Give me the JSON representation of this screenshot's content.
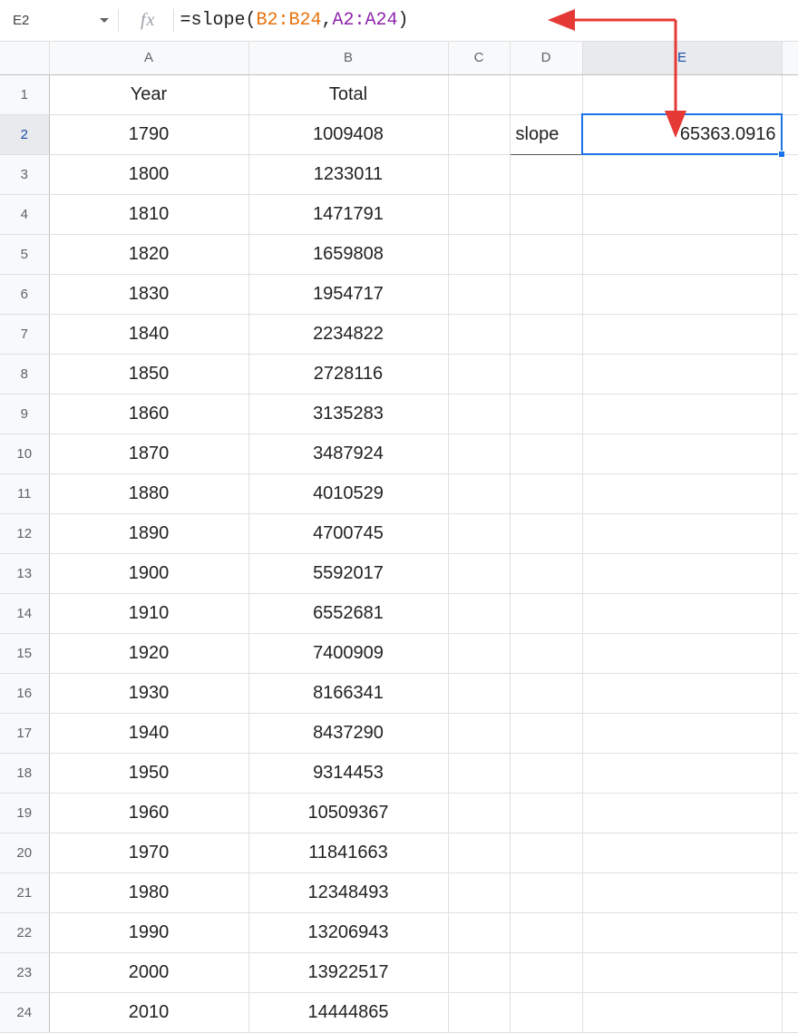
{
  "name_box": "E2",
  "formula": {
    "eq": "=",
    "fn": "slope",
    "lp": "(",
    "r1": "B2:B24",
    "comma": ",",
    "r2": "A2:A24",
    "rp": ")"
  },
  "columns": [
    "A",
    "B",
    "C",
    "D",
    "E"
  ],
  "active_col_index": 4,
  "active_row_num": 2,
  "row_count": 24,
  "header_row": {
    "A": "Year",
    "B": "Total"
  },
  "cell_D2": "slope",
  "cell_E2": "65363.0916",
  "rows": [
    {
      "A": "1790",
      "B": "1009408"
    },
    {
      "A": "1800",
      "B": "1233011"
    },
    {
      "A": "1810",
      "B": "1471791"
    },
    {
      "A": "1820",
      "B": "1659808"
    },
    {
      "A": "1830",
      "B": "1954717"
    },
    {
      "A": "1840",
      "B": "2234822"
    },
    {
      "A": "1850",
      "B": "2728116"
    },
    {
      "A": "1860",
      "B": "3135283"
    },
    {
      "A": "1870",
      "B": "3487924"
    },
    {
      "A": "1880",
      "B": "4010529"
    },
    {
      "A": "1890",
      "B": "4700745"
    },
    {
      "A": "1900",
      "B": "5592017"
    },
    {
      "A": "1910",
      "B": "6552681"
    },
    {
      "A": "1920",
      "B": "7400909"
    },
    {
      "A": "1930",
      "B": "8166341"
    },
    {
      "A": "1940",
      "B": "8437290"
    },
    {
      "A": "1950",
      "B": "9314453"
    },
    {
      "A": "1960",
      "B": "10509367"
    },
    {
      "A": "1970",
      "B": "11841663"
    },
    {
      "A": "1980",
      "B": "12348493"
    },
    {
      "A": "1990",
      "B": "13206943"
    },
    {
      "A": "2000",
      "B": "13922517"
    },
    {
      "A": "2010",
      "B": "14444865"
    }
  ],
  "selection": {
    "cell": "E2"
  }
}
